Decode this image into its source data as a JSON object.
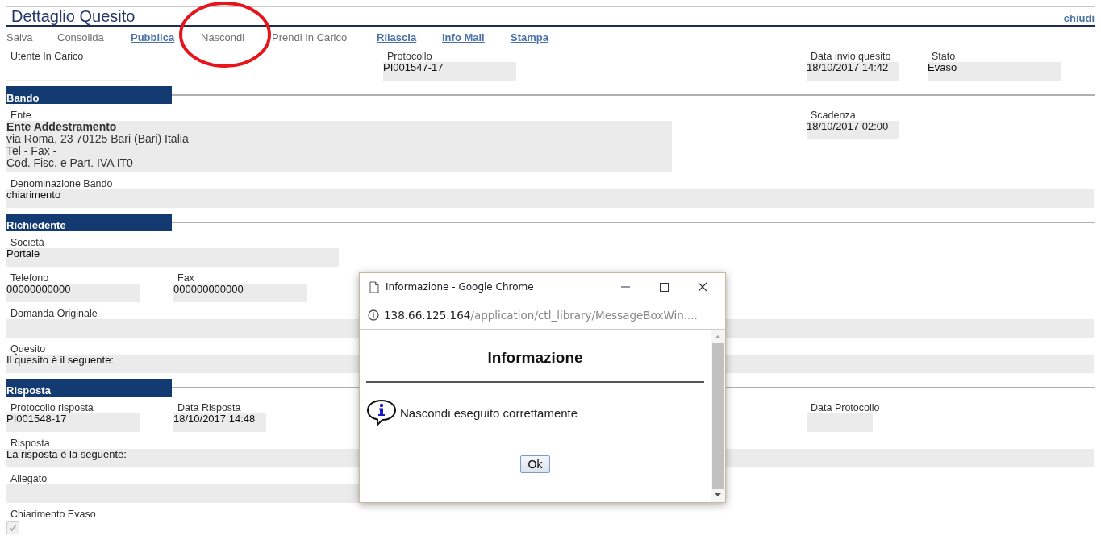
{
  "page": {
    "title": "Dettaglio Quesito",
    "close_link": "chiudi"
  },
  "toolbar": [
    {
      "label": "Salva",
      "disabled": true
    },
    {
      "label": "Consolida",
      "disabled": true
    },
    {
      "label": "Pubblica",
      "disabled": false
    },
    {
      "label": "Nascondi",
      "disabled": true
    },
    {
      "label": "Prendi In Carico",
      "disabled": true
    },
    {
      "label": "Rilascia",
      "disabled": false
    },
    {
      "label": "Info Mail",
      "disabled": false
    },
    {
      "label": "Stampa",
      "disabled": false
    }
  ],
  "summary": {
    "rows": [
      [
        {
          "kind": "plain",
          "label": "Utente In Carico"
        },
        {
          "kind": "field",
          "label": "Protocollo",
          "value": "PI001547-17"
        },
        {
          "kind": "field",
          "label": "Data invio quesito",
          "value": "18/10/2017 14:42"
        },
        {
          "kind": "field",
          "label": "Stato",
          "value": "Evaso"
        }
      ]
    ]
  },
  "sections": [
    {
      "title": "Bando",
      "rows": [
        [
          {
            "kind": "address",
            "label": "Ente",
            "lines": [
              "**Ente Addestramento**",
              "via Roma, 23 70125 Bari (Bari) Italia",
              "Tel - Fax -",
              "Cod. Fisc. e Part. IVA IT0"
            ]
          },
          {
            "kind": "field",
            "label": "Scadenza",
            "value": "18/10/2017 02:00"
          }
        ],
        [
          {
            "kind": "field",
            "label": "Denominazione Bando",
            "value": "chiarimento"
          }
        ]
      ]
    },
    {
      "title": "Richiedente",
      "rows": [
        [
          {
            "kind": "field",
            "label": "Società",
            "value": "Portale"
          }
        ],
        [
          {
            "kind": "field",
            "label": "Telefono",
            "value": "00000000000"
          },
          {
            "kind": "field",
            "label": "Fax",
            "value": "000000000000"
          }
        ],
        [
          {
            "kind": "field",
            "label": "Domanda Originale"
          }
        ],
        [
          {
            "kind": "field",
            "label": "Quesito",
            "value": "Il quesito è il seguente:"
          }
        ]
      ]
    },
    {
      "title": "Risposta",
      "rows": [
        [
          {
            "kind": "field",
            "label": "Protocollo risposta",
            "value": "PI001548-17"
          },
          {
            "kind": "field",
            "label": "Data Risposta",
            "value": "18/10/2017 14:48"
          },
          {
            "kind": "field",
            "label": "Data Protocollo"
          }
        ],
        [
          {
            "kind": "field",
            "label": "Risposta",
            "value": "La risposta è la seguente:"
          }
        ],
        [
          {
            "kind": "field",
            "label": "Allegato"
          }
        ],
        [
          {
            "kind": "checkbox",
            "label": "Chiarimento Evaso",
            "checked": true,
            "disabled": true
          }
        ]
      ]
    }
  ],
  "dialog": {
    "window_title": "Informazione - Google Chrome",
    "url_host": "138.66.125.164",
    "url_path": "/application/ctl_library/MessageBoxWin....",
    "heading": "Informazione",
    "message": "Nascondi eseguito correttamente",
    "button": "Ok"
  }
}
